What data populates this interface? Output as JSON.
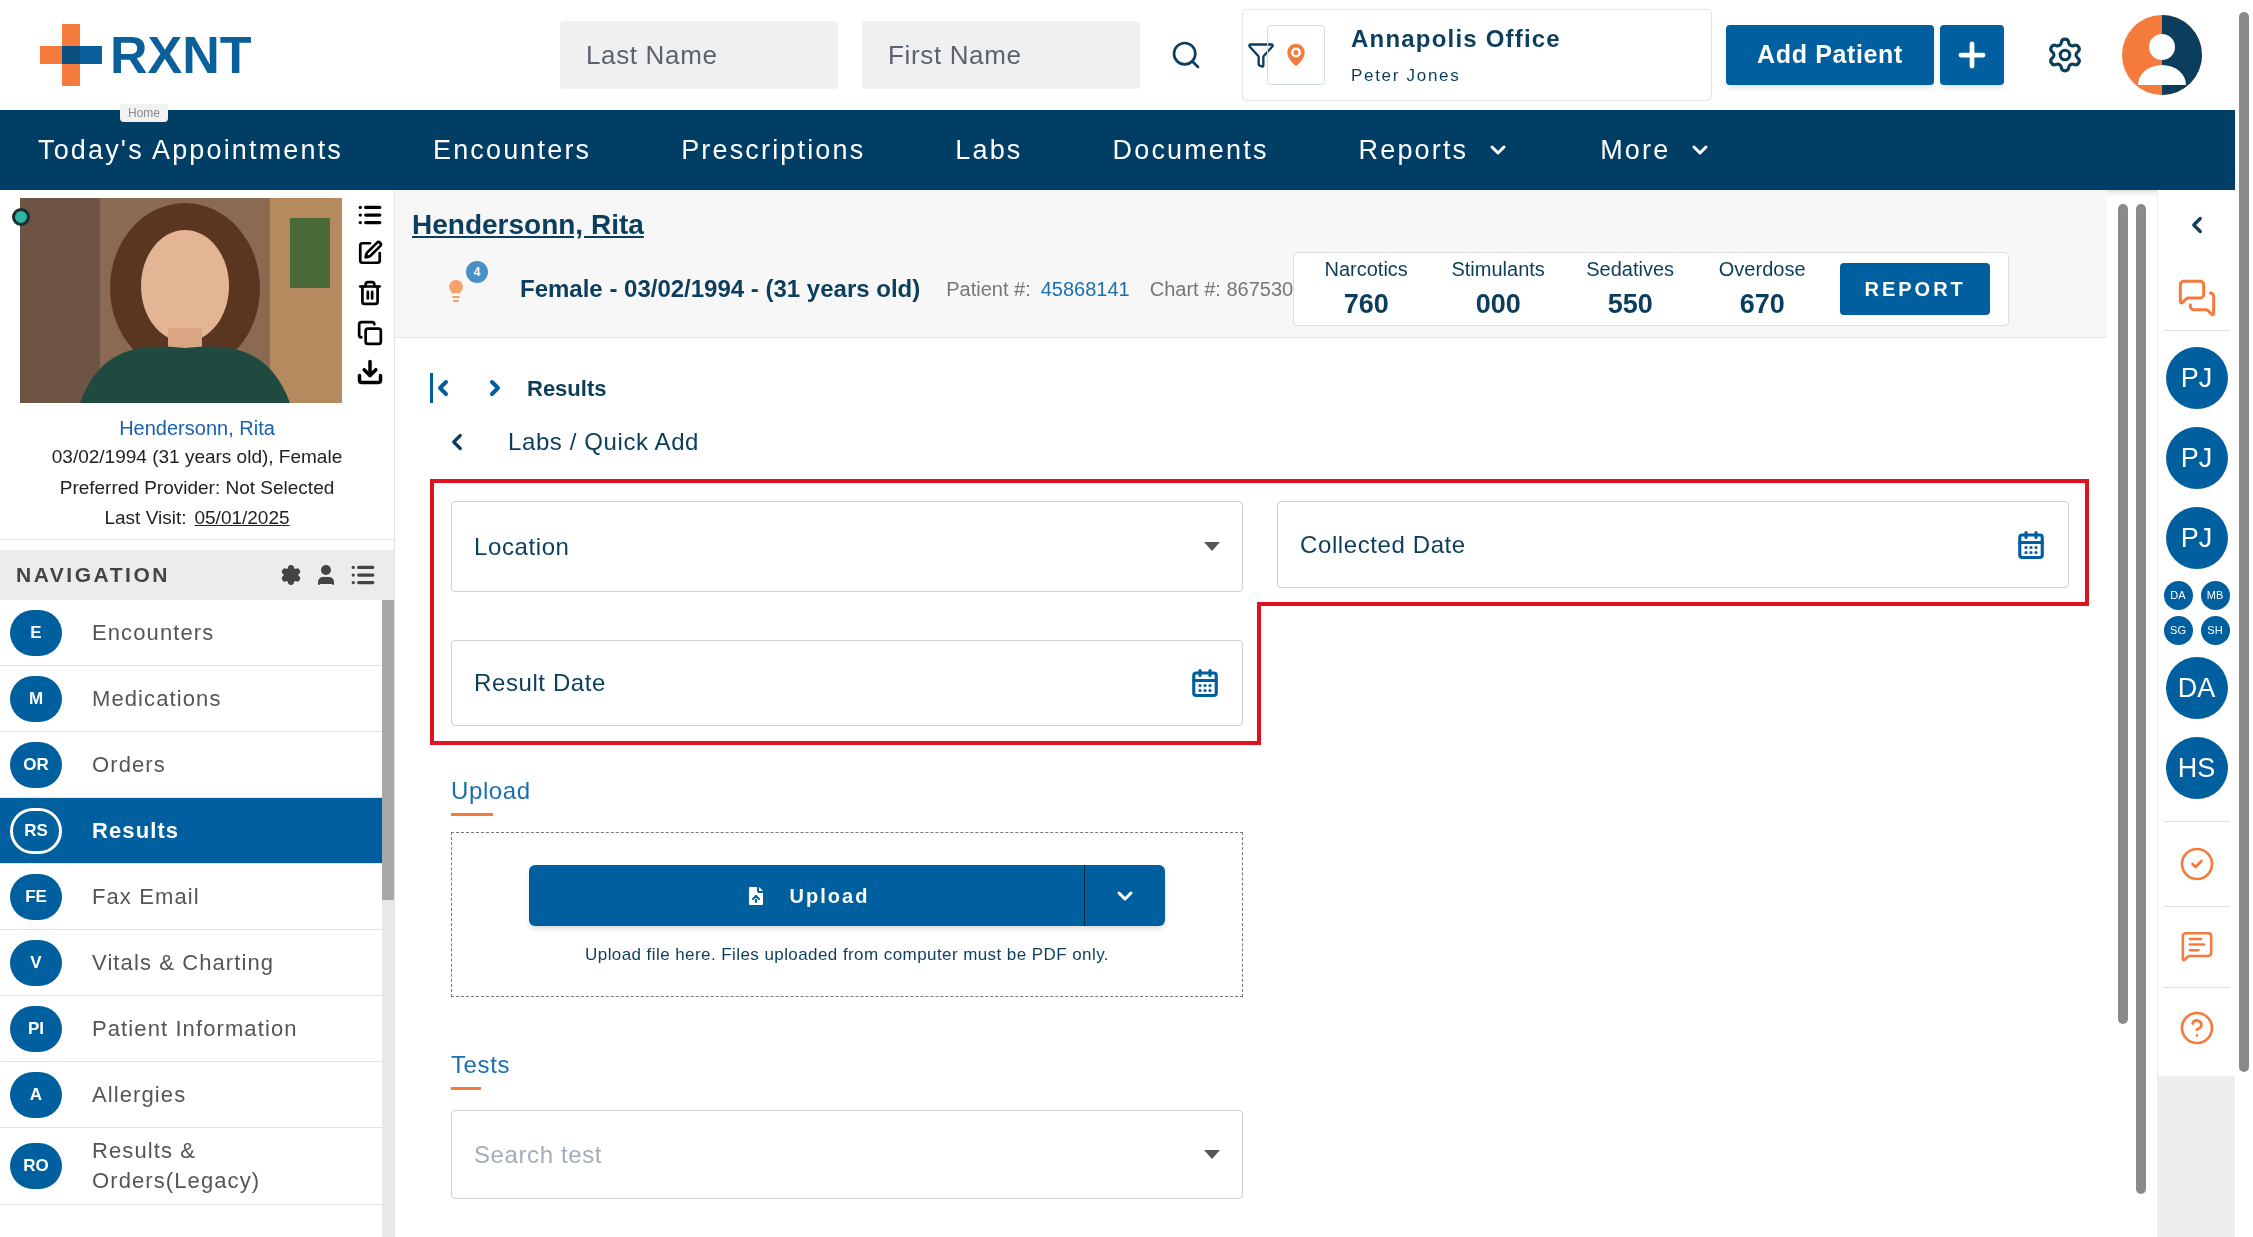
{
  "header": {
    "logo": "RXNT",
    "logo_tooltip": "Home",
    "last_name_placeholder": "Last Name",
    "first_name_placeholder": "First Name",
    "office": {
      "name": "Annapolis Office",
      "user": "Peter Jones"
    },
    "add_patient": "Add Patient"
  },
  "menu": [
    {
      "label": "Today's Appointments",
      "dropdown": false
    },
    {
      "label": "Encounters",
      "dropdown": false
    },
    {
      "label": "Prescriptions",
      "dropdown": false
    },
    {
      "label": "Labs",
      "dropdown": false
    },
    {
      "label": "Documents",
      "dropdown": false
    },
    {
      "label": "Reports",
      "dropdown": true
    },
    {
      "label": "More",
      "dropdown": true
    }
  ],
  "patient_card": {
    "name": "Hendersonn, Rita",
    "dob": "03/02/1994 (31 years old), Female",
    "provider": "Preferred Provider: Not Selected",
    "last_visit_label": "Last Visit:",
    "last_visit": "05/01/2025"
  },
  "navigation": {
    "title": "NAVIGATION",
    "items": [
      {
        "badge": "E",
        "label": "Encounters",
        "selected": false
      },
      {
        "badge": "M",
        "label": "Medications",
        "selected": false
      },
      {
        "badge": "OR",
        "label": "Orders",
        "selected": false
      },
      {
        "badge": "RS",
        "label": "Results",
        "selected": true
      },
      {
        "badge": "FE",
        "label": "Fax Email",
        "selected": false
      },
      {
        "badge": "V",
        "label": "Vitals & Charting",
        "selected": false
      },
      {
        "badge": "PI",
        "label": "Patient Information",
        "selected": false
      },
      {
        "badge": "A",
        "label": "Allergies",
        "selected": false
      },
      {
        "badge": "RO",
        "label": "Results & Orders(Legacy)",
        "selected": false
      }
    ]
  },
  "patient_header": {
    "name": "Hendersonn, Rita",
    "alerts": "4",
    "summary": "Female - 03/02/1994 - (31 years old)",
    "patient_no_label": "Patient #:",
    "patient_no": "45868141",
    "chart_no": "Chart #: 867530",
    "stats": [
      {
        "label": "Narcotics",
        "value": "760"
      },
      {
        "label": "Stimulants",
        "value": "000"
      },
      {
        "label": "Sedatives",
        "value": "550"
      },
      {
        "label": "Overdose",
        "value": "670"
      }
    ],
    "report": "REPORT"
  },
  "breadcrumb": {
    "current": "Results",
    "path": "Labs / Quick Add"
  },
  "form": {
    "fields": [
      {
        "kind": "select",
        "label": "Location"
      },
      {
        "kind": "date",
        "label": "Collected Date"
      },
      {
        "kind": "date",
        "label": "Result Date"
      }
    ],
    "upload": {
      "title": "Upload",
      "button": "Upload",
      "hint": "Upload file here. Files uploaded from computer must be PDF only."
    },
    "tests": {
      "title": "Tests",
      "placeholder": "Search test"
    }
  },
  "right_rail": {
    "contacts": [
      {
        "initials": "PJ",
        "kind": "large"
      },
      {
        "initials": "PJ",
        "kind": "large"
      },
      {
        "initials": "PJ",
        "kind": "large"
      },
      {
        "initials": "DA",
        "kind": "small"
      },
      {
        "initials": "MB",
        "kind": "small"
      },
      {
        "initials": "SG",
        "kind": "small"
      },
      {
        "initials": "SH",
        "kind": "small"
      },
      {
        "initials": "DA",
        "kind": "large"
      },
      {
        "initials": "HS",
        "kind": "large"
      }
    ]
  }
}
